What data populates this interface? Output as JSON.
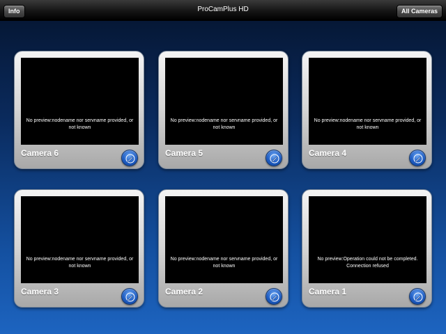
{
  "topbar": {
    "title": "ProCamPlus HD",
    "info_label": "Info",
    "all_cameras_label": "All Cameras"
  },
  "cameras": [
    {
      "name": "Camera 6",
      "message": "No preview:nodename nor servname provided, or not known"
    },
    {
      "name": "Camera 5",
      "message": "No preview:nodename nor servname provided, or not known"
    },
    {
      "name": "Camera 4",
      "message": "No preview:nodename nor servname provided, or not known"
    },
    {
      "name": "Camera 3",
      "message": "No preview:nodename nor servname provided, or not known"
    },
    {
      "name": "Camera 2",
      "message": "No preview:nodename nor servname provided, or not known"
    },
    {
      "name": "Camera 1",
      "message": "No preview:Operation could not be completed. Connection refused"
    }
  ],
  "icons": {
    "edit": "edit-pencil-icon"
  }
}
